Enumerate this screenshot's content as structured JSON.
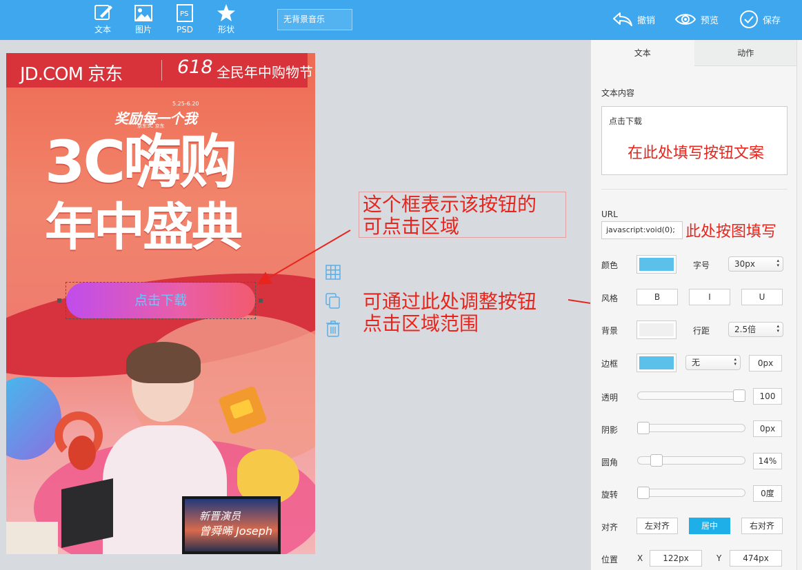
{
  "toolbar": {
    "tools": [
      {
        "label": "文本",
        "icon": "text-edit-icon"
      },
      {
        "label": "图片",
        "icon": "image-icon"
      },
      {
        "label": "PSD",
        "icon": "psd-icon"
      },
      {
        "label": "形状",
        "icon": "star-shape-icon"
      }
    ],
    "music_label": "无背景音乐",
    "undo_label": "撤销",
    "preview_label": "预览",
    "save_label": "保存"
  },
  "poster": {
    "brand": "JD.COM 京东",
    "fest_number": "618",
    "fest_text": "全民年中购物节",
    "date_range": "5.25-6.20",
    "slogan": "奖励每一个我",
    "slogan_sub": "京东3C 京东",
    "headline_line1": "3C嗨购",
    "headline_line2": "年中盛典",
    "button_text": "点击下载",
    "monitor_line1": "新晋演员",
    "monitor_line2": "曾舜晞 Joseph"
  },
  "annotations": {
    "clickable_area": "这个框表示该按钮的\n可点击区域",
    "adjust_area": "可通过此处调整按钮\n点击区域范围",
    "fill_button_text": "在此处填写按钮文案",
    "fill_url": "此处按图填写"
  },
  "panel": {
    "tabs": [
      "文本",
      "动作"
    ],
    "text_content_label": "文本内容",
    "text_content_value": "点击下载",
    "url_label": "URL",
    "url_value": "javascript:void(0);",
    "color_label": "颜色",
    "font_size_label": "字号",
    "font_size_value": "30px",
    "style_label": "风格",
    "style_bold": "B",
    "style_italic": "I",
    "style_underline": "U",
    "background_label": "背景",
    "line_height_label": "行距",
    "line_height_value": "2.5倍",
    "border_label": "边框",
    "border_style_value": "无",
    "border_width_value": "0px",
    "opacity_label": "透明",
    "opacity_value": "100",
    "opacity_fraction": 1.0,
    "shadow_label": "阴影",
    "shadow_value": "0px",
    "shadow_fraction": 0.0,
    "radius_label": "圆角",
    "radius_value": "14%",
    "radius_fraction": 0.14,
    "rotate_label": "旋转",
    "rotate_value": "0度",
    "rotate_fraction": 0.0,
    "align_label": "对齐",
    "align_left": "左对齐",
    "align_center": "居中",
    "align_right": "右对齐",
    "position_label": "位置",
    "pos_x_label": "X",
    "pos_x_value": "122px",
    "pos_y_label": "Y",
    "pos_y_value": "474px"
  },
  "colors": {
    "toolbar_bg": "#3fa7ee",
    "text_color_swatch": "#5bc0ea",
    "border_color_swatch": "#5bc0ea",
    "annotation": "#e8251d",
    "align_active": "#1eaee8"
  }
}
